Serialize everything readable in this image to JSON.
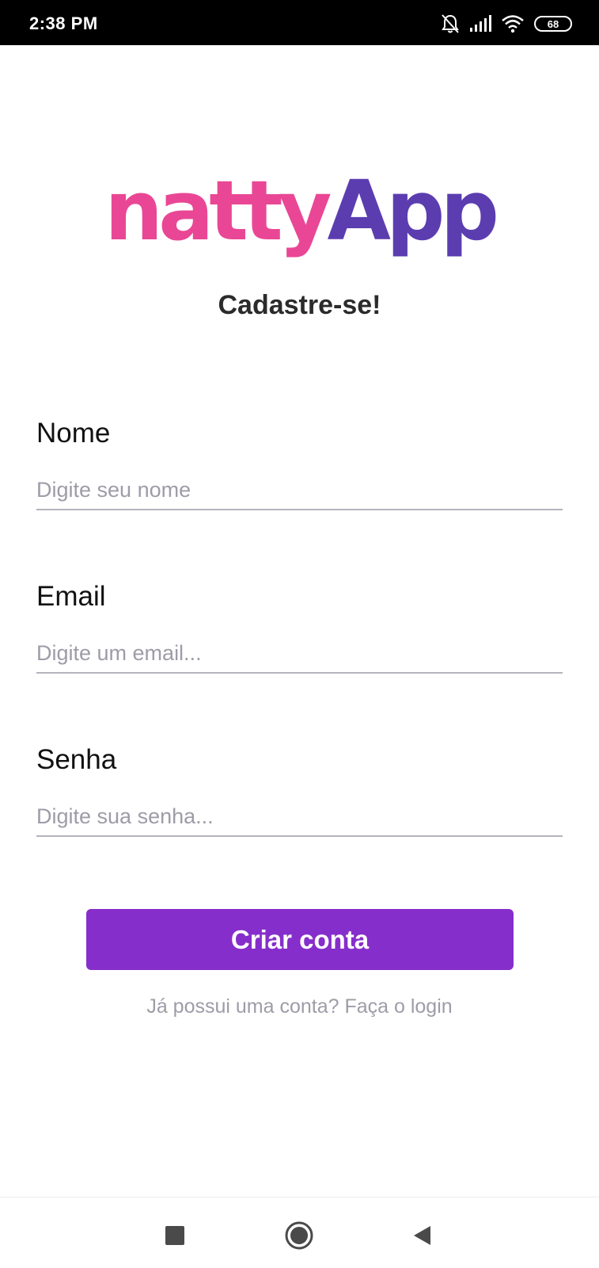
{
  "status_bar": {
    "time": "2:38 PM",
    "battery": "68",
    "icons": [
      "bell-off-icon",
      "signal-icon",
      "wifi-icon",
      "battery-icon"
    ]
  },
  "logo": {
    "part1": "natty",
    "part2": "App",
    "colors": {
      "part1": "#e94795",
      "part2": "#5b3db0"
    }
  },
  "page": {
    "title": "Cadastre-se!"
  },
  "form": {
    "nome": {
      "label": "Nome",
      "placeholder": "Digite seu nome",
      "value": ""
    },
    "email": {
      "label": "Email",
      "placeholder": "Digite um email...",
      "value": ""
    },
    "senha": {
      "label": "Senha",
      "placeholder": "Digite sua senha...",
      "value": ""
    },
    "submit_label": "Criar conta",
    "login_link": "Já possui uma conta? Faça o login"
  },
  "colors": {
    "accent": "#862ecb",
    "muted_text": "#9e9ca7",
    "underline": "#b5b3bd"
  },
  "nav_bar": {
    "icons": [
      "recents-square-icon",
      "home-circle-icon",
      "back-triangle-icon"
    ]
  }
}
